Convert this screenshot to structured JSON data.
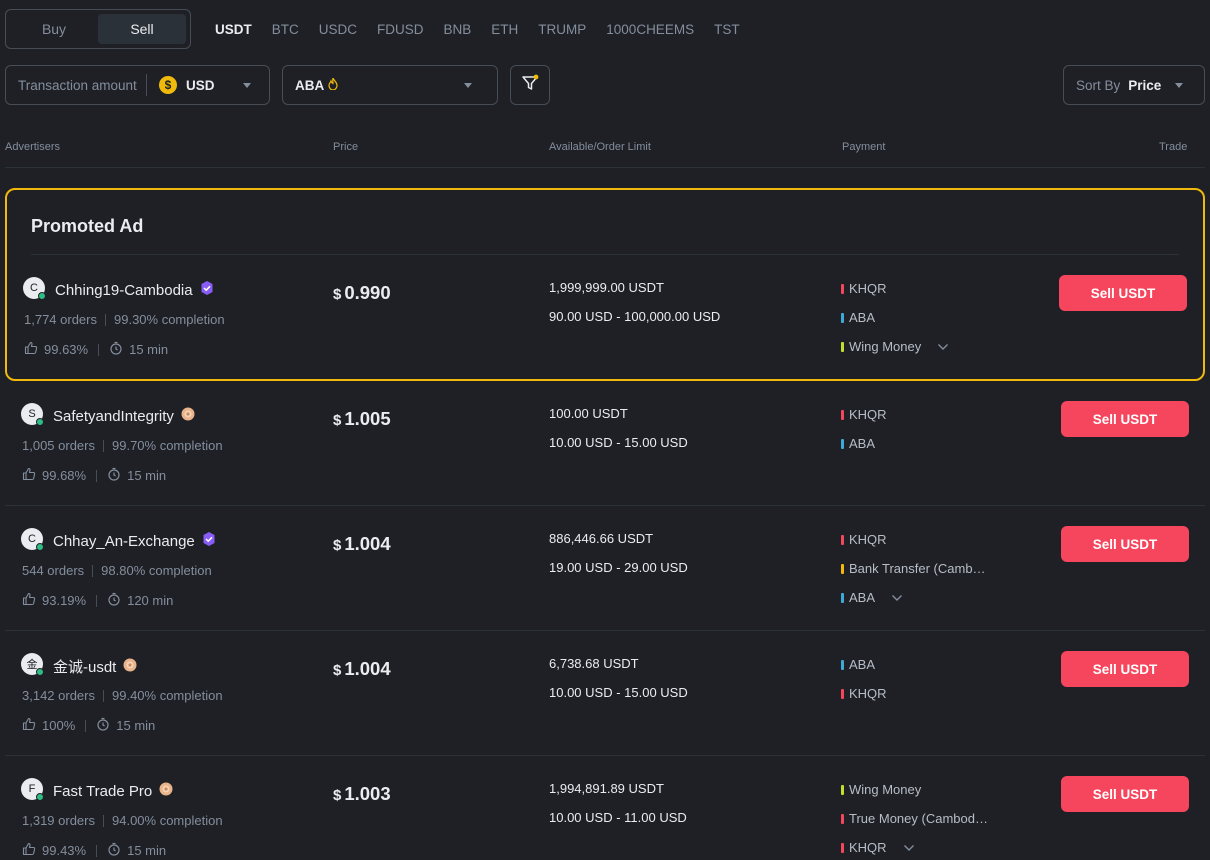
{
  "side_toggle": {
    "buy_label": "Buy",
    "sell_label": "Sell",
    "selected": "Sell"
  },
  "asset_tabs": [
    "USDT",
    "BTC",
    "USDC",
    "FDUSD",
    "BNB",
    "ETH",
    "TRUMP",
    "1000CHEEMS",
    "TST"
  ],
  "active_asset": "USDT",
  "filters": {
    "amount_placeholder": "Transaction amount",
    "currency_symbol": "$",
    "currency": "USD",
    "payment": "ABA",
    "sort_label": "Sort By",
    "sort_value": "Price"
  },
  "table_headers": {
    "advertisers": "Advertisers",
    "price": "Price",
    "available": "Available/Order Limit",
    "payment": "Payment",
    "trade": "Trade"
  },
  "promo_title": "Promoted Ad",
  "rows": [
    {
      "initial": "C",
      "name": "Chhing19-Cambodia",
      "badge": "verified",
      "orders": "1,774 orders",
      "completion": "99.30% completion",
      "rating": "99.63%",
      "time": "15 min",
      "currency_symbol": "$",
      "price": "0.990",
      "available": "1,999,999.00 USDT",
      "limit": "90.00 USD - 100,000.00 USD",
      "payments": [
        {
          "name": "KHQR",
          "color": "#f6465d"
        },
        {
          "name": "ABA",
          "color": "#3fa8d7"
        },
        {
          "name": "Wing Money",
          "color": "#c0e02a"
        }
      ],
      "more_payments": true,
      "button": "Sell USDT"
    },
    {
      "initial": "S",
      "name": "SafetyandIntegrity",
      "badge": "merchant",
      "orders": "1,005 orders",
      "completion": "99.70% completion",
      "rating": "99.68%",
      "time": "15 min",
      "currency_symbol": "$",
      "price": "1.005",
      "available": "100.00 USDT",
      "limit": "10.00 USD - 15.00 USD",
      "payments": [
        {
          "name": "KHQR",
          "color": "#f6465d"
        },
        {
          "name": "ABA",
          "color": "#3fa8d7"
        }
      ],
      "more_payments": false,
      "button": "Sell USDT"
    },
    {
      "initial": "C",
      "name": "Chhay_An-Exchange",
      "badge": "verified",
      "orders": "544 orders",
      "completion": "98.80% completion",
      "rating": "93.19%",
      "time": "120 min",
      "currency_symbol": "$",
      "price": "1.004",
      "available": "886,446.66 USDT",
      "limit": "19.00 USD - 29.00 USD",
      "payments": [
        {
          "name": "KHQR",
          "color": "#f6465d"
        },
        {
          "name": "Bank Transfer (Camb…",
          "color": "#f0b90b"
        },
        {
          "name": "ABA",
          "color": "#3fa8d7"
        }
      ],
      "more_payments": true,
      "button": "Sell USDT"
    },
    {
      "initial": "金",
      "name": "金诚-usdt",
      "badge": "merchant",
      "orders": "3,142 orders",
      "completion": "99.40% completion",
      "rating": "100%",
      "time": "15 min",
      "currency_symbol": "$",
      "price": "1.004",
      "available": "6,738.68 USDT",
      "limit": "10.00 USD - 15.00 USD",
      "payments": [
        {
          "name": "ABA",
          "color": "#3fa8d7"
        },
        {
          "name": "KHQR",
          "color": "#f6465d"
        }
      ],
      "more_payments": false,
      "button": "Sell USDT"
    },
    {
      "initial": "F",
      "name": "Fast Trade Pro",
      "badge": "merchant",
      "orders": "1,319 orders",
      "completion": "94.00% completion",
      "rating": "99.43%",
      "time": "15 min",
      "currency_symbol": "$",
      "price": "1.003",
      "available": "1,994,891.89 USDT",
      "limit": "10.00 USD - 11.00 USD",
      "payments": [
        {
          "name": "Wing Money",
          "color": "#c0e02a"
        },
        {
          "name": "True Money (Cambod…",
          "color": "#f6465d"
        },
        {
          "name": "KHQR",
          "color": "#f6465d"
        }
      ],
      "more_payments": true,
      "button": "Sell USDT"
    }
  ]
}
